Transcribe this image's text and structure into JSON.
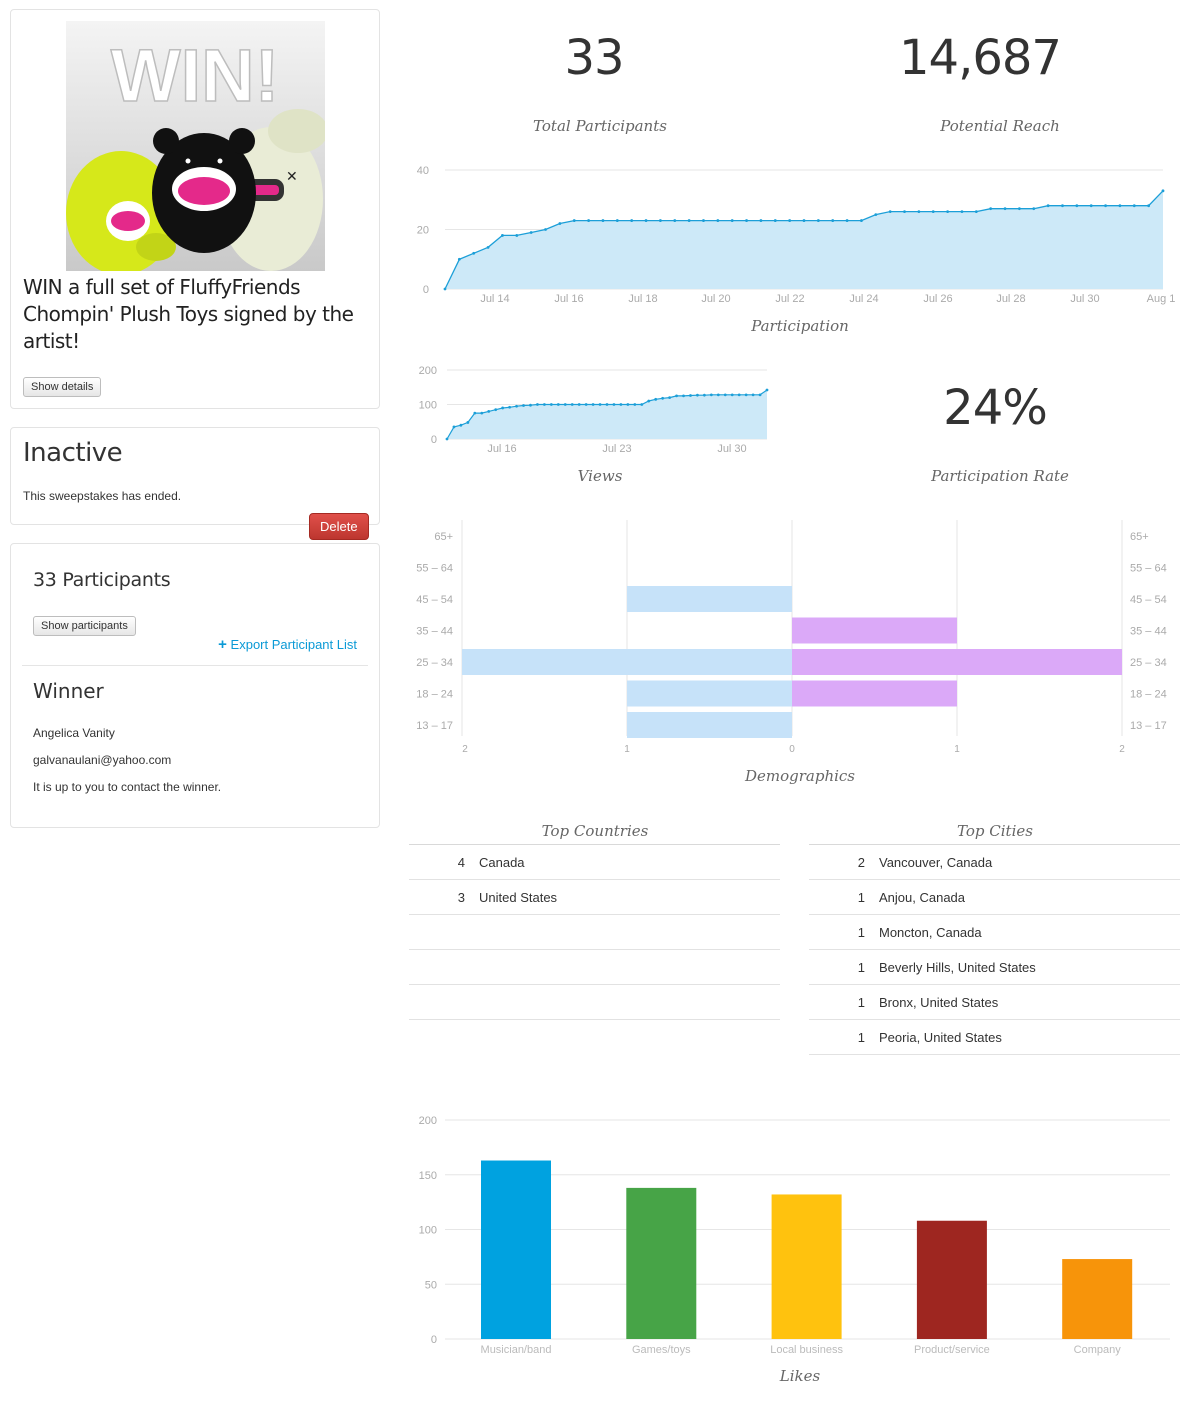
{
  "sweepstakes": {
    "prize_image_text": "WIN!",
    "title": "WIN a full set of FluffyFriends Chompin' Plush Toys signed by the artist!",
    "show_details_label": "Show details"
  },
  "status": {
    "heading": "Inactive",
    "message": "This sweepstakes has ended.",
    "delete_label": "Delete"
  },
  "participants": {
    "heading": "33 Participants",
    "show_label": "Show participants",
    "export_icon": "plus-icon",
    "export_label": "Export Participant List",
    "winner_heading": "Winner",
    "winner_name": "Angelica Vanity",
    "winner_email": "galvanaulani@yahoo.com",
    "winner_note": "It is up to you to contact the winner."
  },
  "stats": {
    "total_participants": "33",
    "total_participants_label": "Total Participants",
    "potential_reach": "14,687",
    "potential_reach_label": "Potential Reach",
    "participation_rate": "24%",
    "participation_rate_label": "Participation Rate"
  },
  "colors": {
    "line": "#1c9fd8",
    "area": "#cde9f8",
    "male": "#c6e2f9",
    "female": "#dba9f8",
    "delete": "#c9302c",
    "link": "#0b9ad6"
  },
  "chart_data": [
    {
      "type": "area",
      "title": "Participation",
      "x_labels": [
        "Jul 14",
        "Jul 16",
        "Jul 18",
        "Jul 20",
        "Jul 22",
        "Jul 24",
        "Jul 26",
        "Jul 28",
        "Jul 30",
        "Aug 1"
      ],
      "y_ticks": [
        0,
        20,
        40
      ],
      "ylim": [
        0,
        40
      ],
      "start": "Jul 12",
      "step": "12h",
      "values": [
        0,
        10,
        12,
        14,
        18,
        18,
        19,
        20,
        22,
        23,
        23,
        23,
        23,
        23,
        23,
        23,
        23,
        23,
        23,
        23,
        23,
        23,
        23,
        23,
        23,
        23,
        23,
        23,
        23,
        23,
        25,
        26,
        26,
        26,
        26,
        26,
        26,
        26,
        27,
        27,
        27,
        27,
        28,
        28,
        28,
        28,
        28,
        28,
        28,
        28,
        33
      ],
      "grid": true
    },
    {
      "type": "area",
      "title": "Views",
      "x_labels": [
        "Jul 16",
        "Jul 23",
        "Jul 30"
      ],
      "y_ticks": [
        0,
        100,
        200
      ],
      "ylim": [
        0,
        200
      ],
      "start": "Jul 12",
      "step": "12h",
      "values": [
        0,
        35,
        40,
        48,
        75,
        75,
        80,
        85,
        90,
        92,
        95,
        97,
        98,
        100,
        100,
        100,
        100,
        100,
        100,
        100,
        100,
        100,
        100,
        100,
        100,
        100,
        100,
        100,
        100,
        110,
        115,
        118,
        120,
        125,
        125,
        126,
        127,
        127,
        128,
        128,
        128,
        128,
        128,
        128,
        128,
        128,
        142
      ],
      "grid": true
    },
    {
      "type": "bar",
      "title": "Demographics",
      "orientation": "horizontal-diverging",
      "categories": [
        "65+",
        "55 – 64",
        "45 – 54",
        "35 – 44",
        "25 – 34",
        "18 – 24",
        "13 – 17"
      ],
      "series": [
        {
          "values": [
            0,
            0,
            1,
            0,
            2,
            1,
            1
          ],
          "color": "#c6e2f9"
        },
        {
          "values": [
            0,
            0,
            0,
            1,
            2,
            1,
            0
          ],
          "color": "#dba9f8"
        }
      ],
      "x_ticks": [
        "2",
        "1",
        "0",
        "1",
        "2"
      ],
      "xlim": [
        -2,
        2
      ]
    },
    {
      "type": "table",
      "title": "Top Countries",
      "rows": [
        {
          "count": "4",
          "name": "Canada"
        },
        {
          "count": "3",
          "name": "United States"
        },
        {
          "count": "",
          "name": ""
        },
        {
          "count": "",
          "name": ""
        },
        {
          "count": "",
          "name": ""
        }
      ]
    },
    {
      "type": "table",
      "title": "Top Cities",
      "rows": [
        {
          "count": "2",
          "name": "Vancouver, Canada"
        },
        {
          "count": "1",
          "name": "Anjou, Canada"
        },
        {
          "count": "1",
          "name": "Moncton, Canada"
        },
        {
          "count": "1",
          "name": "Beverly Hills, United States"
        },
        {
          "count": "1",
          "name": "Bronx, United States"
        },
        {
          "count": "1",
          "name": "Peoria, United States"
        }
      ]
    },
    {
      "type": "bar",
      "title": "Likes",
      "categories": [
        "Musician/band",
        "Games/toys",
        "Local business",
        "Product/service",
        "Company"
      ],
      "values": [
        163,
        138,
        132,
        108,
        73
      ],
      "colors": [
        "#00a2e0",
        "#47a447",
        "#ffc20e",
        "#9e2620",
        "#f7940a"
      ],
      "y_ticks": [
        0,
        50,
        100,
        150,
        200
      ],
      "ylim": [
        0,
        200
      ],
      "grid": true
    }
  ]
}
